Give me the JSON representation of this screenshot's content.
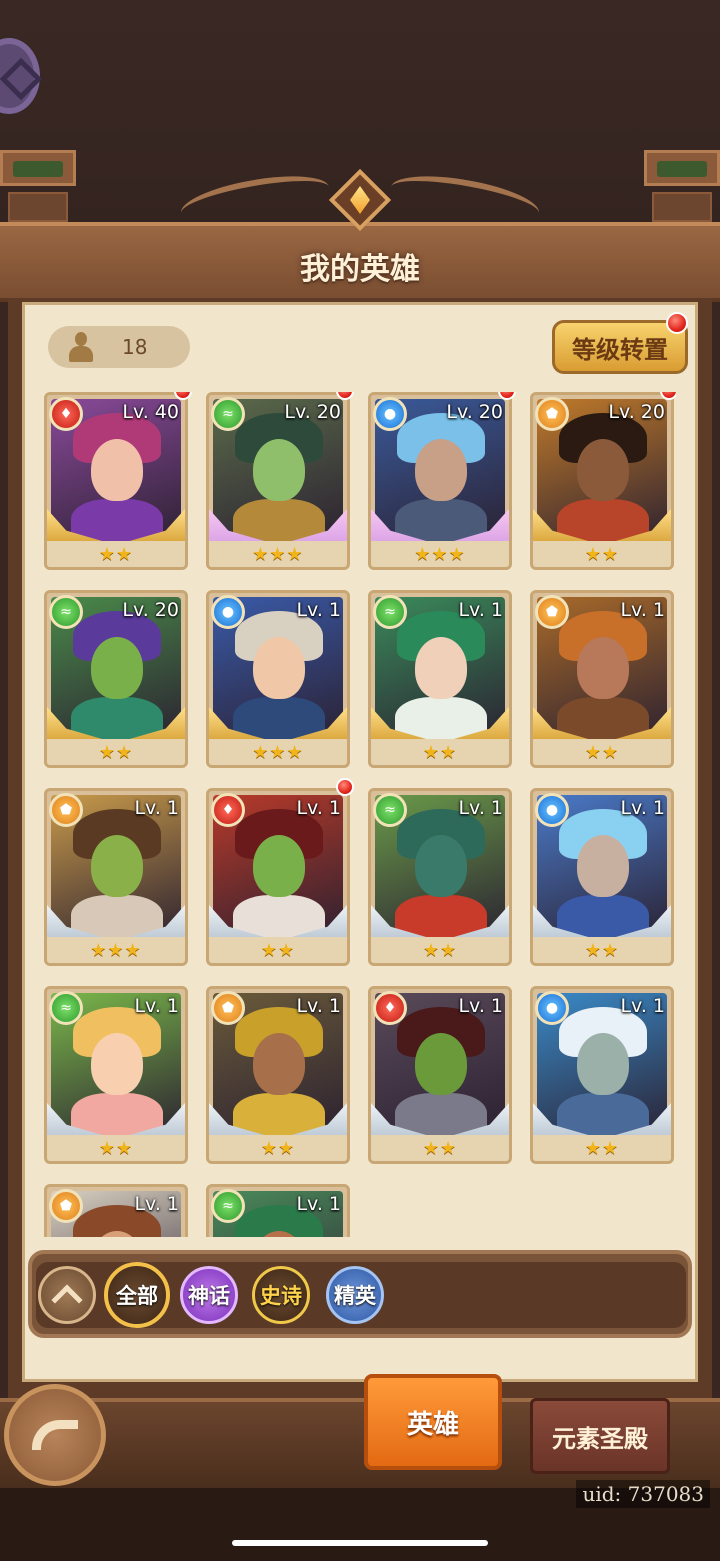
{
  "header": {
    "title": "我的英雄"
  },
  "hero_count": "18",
  "level_transfer_label": "等级转置",
  "heroes": [
    {
      "level": "Lv. 40",
      "element": "fire",
      "stars": "★★",
      "frame": "gold",
      "hair": "#b03a78",
      "skin": "#f0c0a8",
      "body": "#7a3aa8",
      "bg": "#8a4a9a",
      "new": true
    },
    {
      "level": "Lv. 20",
      "element": "wind",
      "stars": "★★★",
      "frame": "pink",
      "hair": "#2e4a3a",
      "skin": "#8fbf6a",
      "body": "#b48a3a",
      "bg": "#5a6a4a",
      "new": true
    },
    {
      "level": "Lv. 20",
      "element": "water",
      "stars": "★★★",
      "frame": "pink",
      "hair": "#7ac0e8",
      "skin": "#c8a088",
      "body": "#4a5a78",
      "bg": "#3a5a9a",
      "new": true
    },
    {
      "level": "Lv. 20",
      "element": "earth",
      "stars": "★★",
      "frame": "gold",
      "hair": "#2a1a12",
      "skin": "#8a5a3a",
      "body": "#b8452a",
      "bg": "#c07a2a",
      "new": true
    },
    {
      "level": "Lv. 20",
      "element": "wind",
      "stars": "★★",
      "frame": "gold",
      "hair": "#5a3a9a",
      "skin": "#7ab04a",
      "body": "#2e8a6a",
      "bg": "#4a8a4a",
      "new": false
    },
    {
      "level": "Lv. 1",
      "element": "water",
      "stars": "★★★",
      "frame": "gold",
      "hair": "#d8d0c0",
      "skin": "#f0c8a8",
      "body": "#2e4a7a",
      "bg": "#3a5aa8",
      "new": false
    },
    {
      "level": "Lv. 1",
      "element": "wind",
      "stars": "★★",
      "frame": "gold",
      "hair": "#2a8a5a",
      "skin": "#f0d0b8",
      "body": "#e8f0e8",
      "bg": "#3a8a5a",
      "new": false
    },
    {
      "level": "Lv. 1",
      "element": "earth",
      "stars": "★★",
      "frame": "gold",
      "hair": "#c8702a",
      "skin": "#b8785a",
      "body": "#7a4a2a",
      "bg": "#a86a2a",
      "new": false
    },
    {
      "level": "Lv. 1",
      "element": "earth",
      "stars": "★★★",
      "frame": "silver",
      "hair": "#5a3a22",
      "skin": "#8ab04a",
      "body": "#d8c8b8",
      "bg": "#c89a4a",
      "new": false
    },
    {
      "level": "Lv. 1",
      "element": "fire",
      "stars": "★★",
      "frame": "silver",
      "hair": "#6a1a1a",
      "skin": "#7ab04a",
      "body": "#e8e0d8",
      "bg": "#b83a2a",
      "new": true
    },
    {
      "level": "Lv. 1",
      "element": "wind",
      "stars": "★★",
      "frame": "silver",
      "hair": "#2e6a5a",
      "skin": "#3a7a6a",
      "body": "#c83a2a",
      "bg": "#6a9a4a",
      "new": false
    },
    {
      "level": "Lv. 1",
      "element": "water",
      "stars": "★★",
      "frame": "silver",
      "hair": "#8ad0f0",
      "skin": "#c8b0a0",
      "body": "#3a5aa8",
      "bg": "#4a7ac8",
      "new": false
    },
    {
      "level": "Lv. 1",
      "element": "wind",
      "stars": "★★",
      "frame": "silver",
      "hair": "#f0c060",
      "skin": "#f8d0b0",
      "body": "#f0a8a0",
      "bg": "#7ab84a",
      "new": false
    },
    {
      "level": "Lv. 1",
      "element": "earth",
      "stars": "★★",
      "frame": "silver",
      "hair": "#c8a02a",
      "skin": "#a8704a",
      "body": "#d8b03a",
      "bg": "#6a5a3a",
      "new": false
    },
    {
      "level": "Lv. 1",
      "element": "fire",
      "stars": "★★",
      "frame": "silver",
      "hair": "#4a1a1a",
      "skin": "#6a9a3a",
      "body": "#7a7a8a",
      "bg": "#5a4a5a",
      "new": false
    },
    {
      "level": "Lv. 1",
      "element": "water",
      "stars": "★★",
      "frame": "silver",
      "hair": "#e8f0f8",
      "skin": "#9ab0a8",
      "body": "#4a6a9a",
      "bg": "#3a8ac8",
      "new": false
    },
    {
      "level": "Lv. 1",
      "element": "earth",
      "stars": "",
      "frame": "none",
      "hair": "#8a4a2a",
      "skin": "#d8a078",
      "body": "#e8e0d0",
      "bg": "#d8d0c0",
      "new": false
    },
    {
      "level": "Lv. 1",
      "element": "wind",
      "stars": "",
      "frame": "none",
      "hair": "#2a7a4a",
      "skin": "#b8704a",
      "body": "#3a6a3a",
      "bg": "#4a8a5a",
      "new": false
    }
  ],
  "filters": {
    "all": "全部",
    "myth": "神话",
    "epic": "史诗",
    "elite": "精英"
  },
  "tabs": {
    "hero": "英雄",
    "temple": "元素圣殿"
  },
  "uid": "uid: 737083",
  "element_icons": {
    "fire": "fire-element-icon",
    "wind": "wind-element-icon",
    "water": "water-element-icon",
    "earth": "earth-element-icon"
  }
}
